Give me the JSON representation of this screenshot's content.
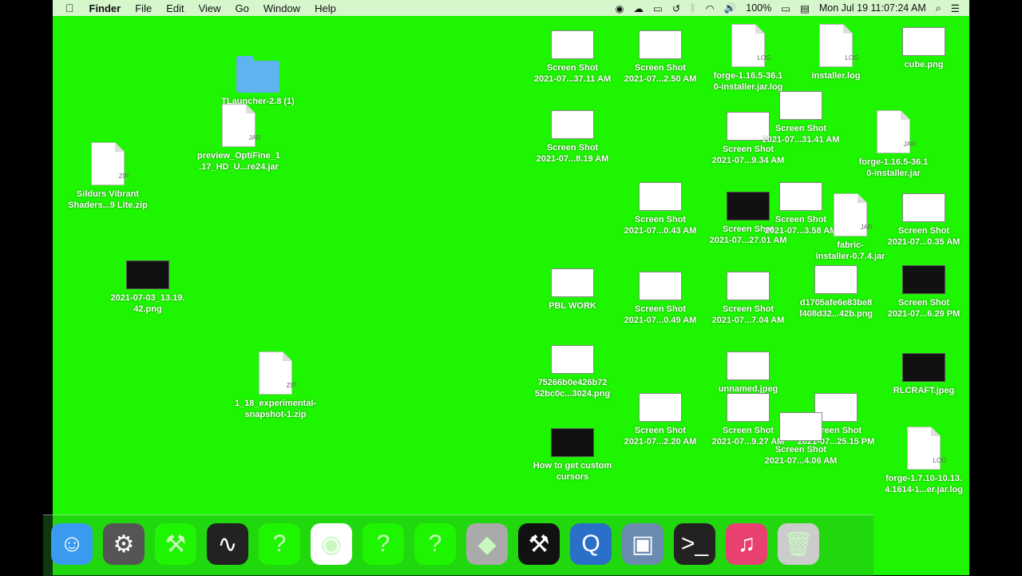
{
  "menubar": {
    "apple": "",
    "app": "Finder",
    "menus": [
      "File",
      "Edit",
      "View",
      "Go",
      "Window",
      "Help"
    ],
    "battery": "100%",
    "clock": "Mon Jul 19  11:07:24 AM"
  },
  "desktop": {
    "icons": [
      {
        "label": "TLauncher-2.8 (1)",
        "kind": "folder"
      },
      {
        "label": "preview_OptiFine_1\n.17_HD_U...re24.jar",
        "kind": "jar",
        "tag": "JAR"
      },
      {
        "label": "Sildurs Vibrant\nShaders...9 Lite.zip",
        "kind": "zip",
        "tag": "ZIP"
      },
      {
        "label": "2021-07-03_13.19.\n42.png",
        "kind": "photo"
      },
      {
        "label": "1_18_experimental-\nsnapshot-1.zip",
        "kind": "zip",
        "tag": "ZIP"
      },
      {
        "label": "Screen Shot\n2021-07...37.11 AM",
        "kind": "shot"
      },
      {
        "label": "Screen Shot\n2021-07...2.50 AM",
        "kind": "shot"
      },
      {
        "label": "forge-1.16.5-36.1\n0-installer.jar.log",
        "kind": "log",
        "tag": "LOG"
      },
      {
        "label": "installer.log",
        "kind": "log",
        "tag": "LOG"
      },
      {
        "label": "cube.png",
        "kind": "shot"
      },
      {
        "label": "Screen Shot\n2021-07...8.19 AM",
        "kind": "shot"
      },
      {
        "label": "Screen Shot\n2021-07...9.34 AM",
        "kind": "shot"
      },
      {
        "label": "Screen Shot\n2021-07...31.41 AM",
        "kind": "shot"
      },
      {
        "label": "forge-1.16.5-36.1\n0-installer.jar",
        "kind": "jar",
        "tag": "JAR"
      },
      {
        "label": "Screen Shot\n2021-07...0.43 AM",
        "kind": "shot"
      },
      {
        "label": "Screen Shot\n2021-07...27.01 AM",
        "kind": "dark"
      },
      {
        "label": "Screen Shot\n2021-07...3.58 AM",
        "kind": "shot"
      },
      {
        "label": "fabric-\ninstaller-0.7.4.jar",
        "kind": "jar",
        "tag": "JAR"
      },
      {
        "label": "Screen Shot\n2021-07...0.35 AM",
        "kind": "shot"
      },
      {
        "label": "PBL WORK",
        "kind": "shot"
      },
      {
        "label": "Screen Shot\n2021-07...0.49 AM",
        "kind": "shot"
      },
      {
        "label": "Screen Shot\n2021-07...7.04 AM",
        "kind": "shot"
      },
      {
        "label": "d1705afe6e83be8\nf408d32...42b.png",
        "kind": "shot"
      },
      {
        "label": "Screen Shot\n2021-07...6.29 PM",
        "kind": "dark"
      },
      {
        "label": "75266b0e426b72\n52bc0c...3024.png",
        "kind": "shot"
      },
      {
        "label": "unnamed.jpeg",
        "kind": "shot"
      },
      {
        "label": "RLCRAFT.jpeg",
        "kind": "photo"
      },
      {
        "label": "Screen Shot\n2021-07...2.20 AM",
        "kind": "shot"
      },
      {
        "label": "Screen Shot\n2021-07...9.27 AM",
        "kind": "shot"
      },
      {
        "label": "Screen Shot\n2021-07...25.15 PM",
        "kind": "shot"
      },
      {
        "label": "Screen Shot\n2021-07...4.06 AM",
        "kind": "shot"
      },
      {
        "label": "How to get custom\ncursors",
        "kind": "dark"
      },
      {
        "label": "forge-1.7.10-10.13.\n4.1614-1...er.jar.log",
        "kind": "log",
        "tag": "LOG"
      }
    ]
  },
  "dock": {
    "apps": [
      {
        "name": "Finder",
        "glyph": "☺"
      },
      {
        "name": "System Preferences",
        "glyph": "⚙"
      },
      {
        "name": "Archive Utility",
        "glyph": "⚒"
      },
      {
        "name": "Activity Monitor",
        "glyph": "∿"
      },
      {
        "name": "Unknown",
        "glyph": "?"
      },
      {
        "name": "Google Chrome",
        "glyph": "◉"
      },
      {
        "name": "Unknown",
        "glyph": "?"
      },
      {
        "name": "Unknown",
        "glyph": "?"
      },
      {
        "name": "Roblox",
        "glyph": "◆"
      },
      {
        "name": "CurseForge",
        "glyph": "⚒"
      },
      {
        "name": "QuickTime Player",
        "glyph": "Q"
      },
      {
        "name": "Preview",
        "glyph": "▣"
      },
      {
        "name": "Terminal",
        "glyph": ">_"
      },
      {
        "name": "Music",
        "glyph": "♫"
      },
      {
        "name": "Trash",
        "glyph": "🗑"
      }
    ]
  },
  "colors": {
    "desktop": "#1ef500",
    "menubar": "#d6f7cc"
  }
}
